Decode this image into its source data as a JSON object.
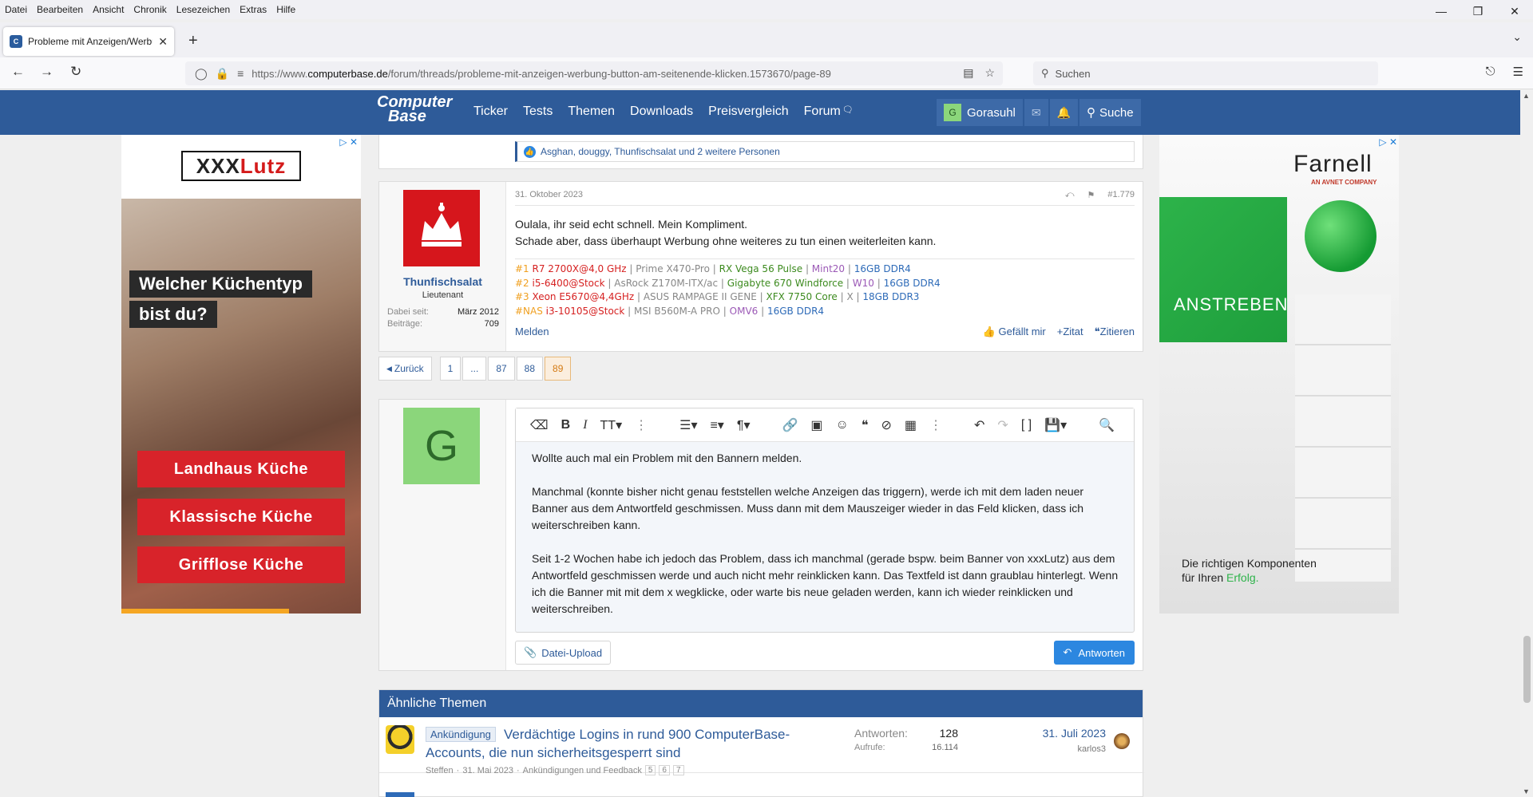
{
  "browser": {
    "menu": [
      "Datei",
      "Bearbeiten",
      "Ansicht",
      "Chronik",
      "Lesezeichen",
      "Extras",
      "Hilfe"
    ],
    "tab_title": "Probleme mit Anzeigen/Werbu",
    "url_prefix": "https://www.",
    "url_domain": "computerbase.de",
    "url_path": "/forum/threads/probleme-mit-anzeigen-werbung-button-am-seitenende-klicken.1573670/page-89",
    "search_placeholder": "Suchen"
  },
  "site": {
    "logo_line1": "Computer",
    "logo_line2": "Base",
    "nav": [
      "Ticker",
      "Tests",
      "Themen",
      "Downloads",
      "Preisvergleich",
      "Forum"
    ],
    "user_initial": "G",
    "username": "Gorasuhl",
    "search_label": "Suche"
  },
  "ads": {
    "left": {
      "brand_part1": "XXX",
      "brand_part2": "Lutz",
      "headline_line1": "Welcher Küchentyp",
      "headline_line2": "bist du?",
      "buttons": [
        "Landhaus Küche",
        "Klassische Küche",
        "Grifflose Küche"
      ]
    },
    "right": {
      "brand": "Farnell",
      "sub": "AN AVNET COMPANY",
      "slogan": "ANSTREBEN",
      "tag_line1": "Die richtigen Komponenten",
      "tag_line2_prefix": "für Ihren ",
      "tag_line2_accent": "Erfolg."
    }
  },
  "prev_post": {
    "likes": "Asghan, douggy, Thunfischsalat und 2 weitere Personen"
  },
  "post": {
    "author": "Thunfischsalat",
    "rank": "Lieutenant",
    "joined_label": "Dabei seit:",
    "joined": "März 2012",
    "posts_label": "Beiträge:",
    "posts": "709",
    "date": "31. Oktober 2023",
    "number": "#1.779",
    "body_line1": "Oulala, ihr seid echt schnell. Mein Kompliment.",
    "body_line2": "Schade aber, dass überhaupt Werbung ohne weiteres zu tun einen weiterleiten kann.",
    "signature": [
      {
        "tag": "#1",
        "cpu": "R7 2700X@4,0 GHz",
        "board": "Prime X470-Pro",
        "gpu": "RX Vega 56 Pulse",
        "os": "Mint20",
        "ram": "16GB DDR4"
      },
      {
        "tag": "#2",
        "cpu": "i5-6400@Stock",
        "board": "AsRock Z170M-ITX/ac",
        "gpu": "Gigabyte 670 Windforce",
        "os": "W10",
        "ram": "16GB DDR4"
      },
      {
        "tag": "#3",
        "cpu": "Xeon E5670@4,4GHz",
        "board": "ASUS RAMPAGE II GENE",
        "gpu": "XFX 7750 Core",
        "os": "X",
        "ram": "18GB DDR3"
      },
      {
        "tag": "#NAS",
        "cpu": "i3-10105@Stock",
        "board": "MSI B560M-A PRO",
        "gpu": "",
        "os": "OMV6",
        "ram": "16GB DDR4"
      }
    ],
    "report": "Melden",
    "like": "Gefällt mir",
    "quote_plus": "Zitat",
    "quote": "Zitieren"
  },
  "pagination": {
    "back": "Zurück",
    "pages": [
      "1",
      "...",
      "87",
      "88",
      "89"
    ],
    "current": "89"
  },
  "reply": {
    "avatar_initial": "G",
    "paragraphs": [
      "Wollte auch mal ein Problem mit den Bannern melden.",
      "Manchmal (konnte bisher nicht genau feststellen welche Anzeigen das triggern), werde ich mit dem laden neuer Banner aus dem Antwortfeld geschmissen. Muss dann mit dem Mauszeiger wieder in das Feld klicken, dass ich weiterschreiben kann.",
      "Seit 1-2 Wochen habe ich jedoch das Problem, dass ich manchmal (gerade bspw. beim Banner von xxxLutz) aus dem Antwortfeld geschmissen werde und auch nicht mehr reinklicken kann. Das Textfeld ist dann graublau hinterlegt. Wenn ich die Banner mit mit dem x wegklicke, oder warte bis neue geladen werden, kann ich wieder reinklicken und weiterschreiben."
    ],
    "upload": "Datei-Upload",
    "submit": "Antworten"
  },
  "similar": {
    "heading": "Ähnliche Themen",
    "threads": [
      {
        "badge": "Ankündigung",
        "title": "Verdächtige Logins in rund 900 ComputerBase-Accounts, die nun sicherheitsgesperrt sind",
        "author": "Steffen",
        "date": "31. Mai 2023",
        "forum": "Ankündigungen und Feedback",
        "pages": [
          "5",
          "6",
          "7"
        ],
        "replies_label": "Antworten:",
        "replies": "128",
        "views_label": "Aufrufe:",
        "views": "16.114",
        "last_date": "31. Juli 2023",
        "last_user": "karlos3"
      }
    ]
  },
  "colors": {
    "brand_blue": "#2e5b99",
    "accent_blue": "#2c87e0",
    "xxxlutz_red": "#d8232a",
    "farnell_green": "#2db34a"
  }
}
